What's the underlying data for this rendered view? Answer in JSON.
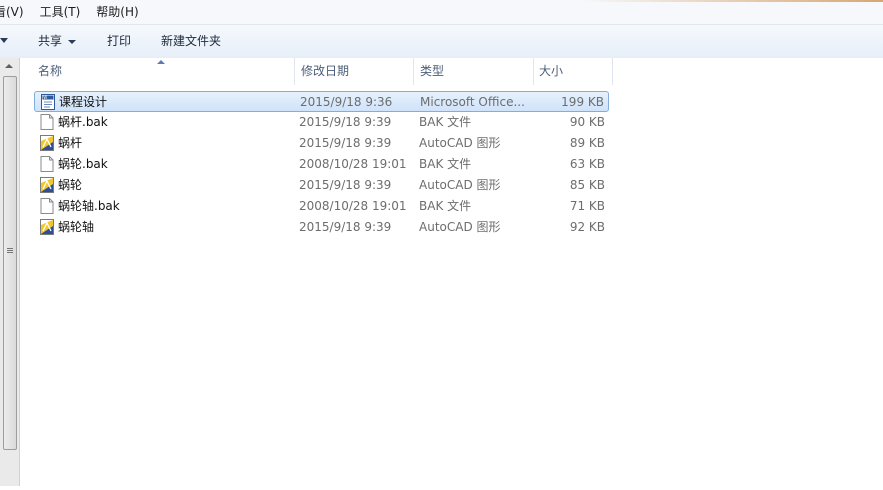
{
  "menubar": {
    "items": [
      "看(V)",
      "工具(T)",
      "帮助(H)"
    ]
  },
  "toolbar": {
    "share_label": "共享",
    "print_label": "打印",
    "new_folder_label": "新建文件夹"
  },
  "columns": {
    "name": "名称",
    "modified": "修改日期",
    "type": "类型",
    "size": "大小"
  },
  "files": [
    {
      "name": "课程设计",
      "modified": "2015/9/18 9:36",
      "type": "Microsoft Office...",
      "size": "199 KB",
      "icon": "word-document-icon",
      "selected": true
    },
    {
      "name": "蜗杆.bak",
      "modified": "2015/9/18 9:39",
      "type": "BAK 文件",
      "size": "90 KB",
      "icon": "blank-file-icon",
      "selected": false
    },
    {
      "name": "蜗杆",
      "modified": "2015/9/18 9:39",
      "type": "AutoCAD 图形",
      "size": "89 KB",
      "icon": "autocad-drawing-icon",
      "selected": false
    },
    {
      "name": "蜗轮.bak",
      "modified": "2008/10/28 19:01",
      "type": "BAK 文件",
      "size": "63 KB",
      "icon": "blank-file-icon",
      "selected": false
    },
    {
      "name": "蜗轮",
      "modified": "2015/9/18 9:39",
      "type": "AutoCAD 图形",
      "size": "85 KB",
      "icon": "autocad-drawing-icon",
      "selected": false
    },
    {
      "name": "蜗轮轴.bak",
      "modified": "2008/10/28 19:01",
      "type": "BAK 文件",
      "size": "71 KB",
      "icon": "blank-file-icon",
      "selected": false
    },
    {
      "name": "蜗轮轴",
      "modified": "2015/9/18 9:39",
      "type": "AutoCAD 图形",
      "size": "92 KB",
      "icon": "autocad-drawing-icon",
      "selected": false
    }
  ],
  "colors": {
    "selection_border": "#84acdd",
    "selection_fill": "#cfe3fa",
    "header_text": "#4c607a",
    "detail_text": "#6d6d6d"
  }
}
